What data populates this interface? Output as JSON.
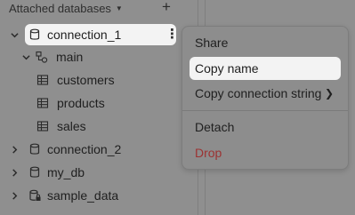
{
  "sidebar": {
    "header": "Attached databases",
    "items": [
      {
        "label": "connection_1"
      },
      {
        "label": "main"
      },
      {
        "label": "customers"
      },
      {
        "label": "products"
      },
      {
        "label": "sales"
      },
      {
        "label": "connection_2"
      },
      {
        "label": "my_db"
      },
      {
        "label": "sample_data"
      }
    ]
  },
  "context_menu": {
    "share": "Share",
    "copy_name": "Copy name",
    "copy_connection_string": "Copy connection string",
    "detach": "Detach",
    "drop": "Drop"
  },
  "colors": {
    "drop": "#9c3232",
    "highlight": "#f3f3f3",
    "overlay": "#8f8f8f"
  }
}
